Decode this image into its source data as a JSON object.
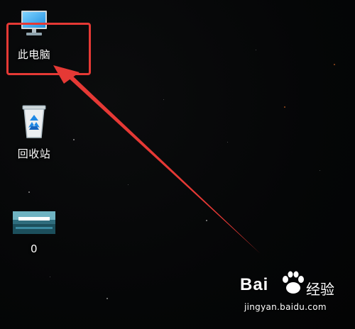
{
  "desktop": {
    "icons": [
      {
        "label": "此电脑",
        "icon": "monitor-icon"
      },
      {
        "label": "回收站",
        "icon": "recycle-bin-icon"
      },
      {
        "label": "0",
        "icon": "image-file-icon"
      }
    ]
  },
  "annotation": {
    "color": "#e53935"
  },
  "watermark": {
    "brand": "Bai",
    "brand_suffix": "经验",
    "url": "jingyan.baidu.com"
  }
}
